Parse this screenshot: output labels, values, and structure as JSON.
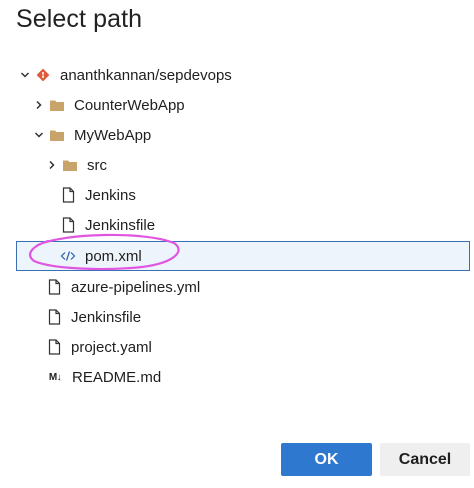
{
  "dialog": {
    "title": "Select path"
  },
  "tree": {
    "items": [
      {
        "label": "ananthkannan/sepdevops",
        "icon": "git-repo-icon",
        "expanded": true
      },
      {
        "label": "CounterWebApp",
        "icon": "folder-icon",
        "expanded": false
      },
      {
        "label": "MyWebApp",
        "icon": "folder-icon",
        "expanded": true
      },
      {
        "label": "src",
        "icon": "folder-icon",
        "expanded": false
      },
      {
        "label": "Jenkins",
        "icon": "file-icon"
      },
      {
        "label": "Jenkinsfile",
        "icon": "file-icon"
      },
      {
        "label": "pom.xml",
        "icon": "code-file-icon",
        "selected": true
      },
      {
        "label": "azure-pipelines.yml",
        "icon": "file-icon"
      },
      {
        "label": "Jenkinsfile",
        "icon": "file-icon"
      },
      {
        "label": "project.yaml",
        "icon": "file-icon"
      },
      {
        "label": "README.md",
        "icon": "markdown-icon",
        "icon_text": "M↓"
      }
    ]
  },
  "buttons": {
    "ok_label": "OK",
    "cancel_label": "Cancel"
  },
  "colors": {
    "primary": "#2f78d0",
    "selection_border": "#3a6fb6",
    "selection_bg": "#eef4fb",
    "annotation": "#e056e0",
    "folder": "#c9a46a",
    "git": "#e05a3a"
  }
}
